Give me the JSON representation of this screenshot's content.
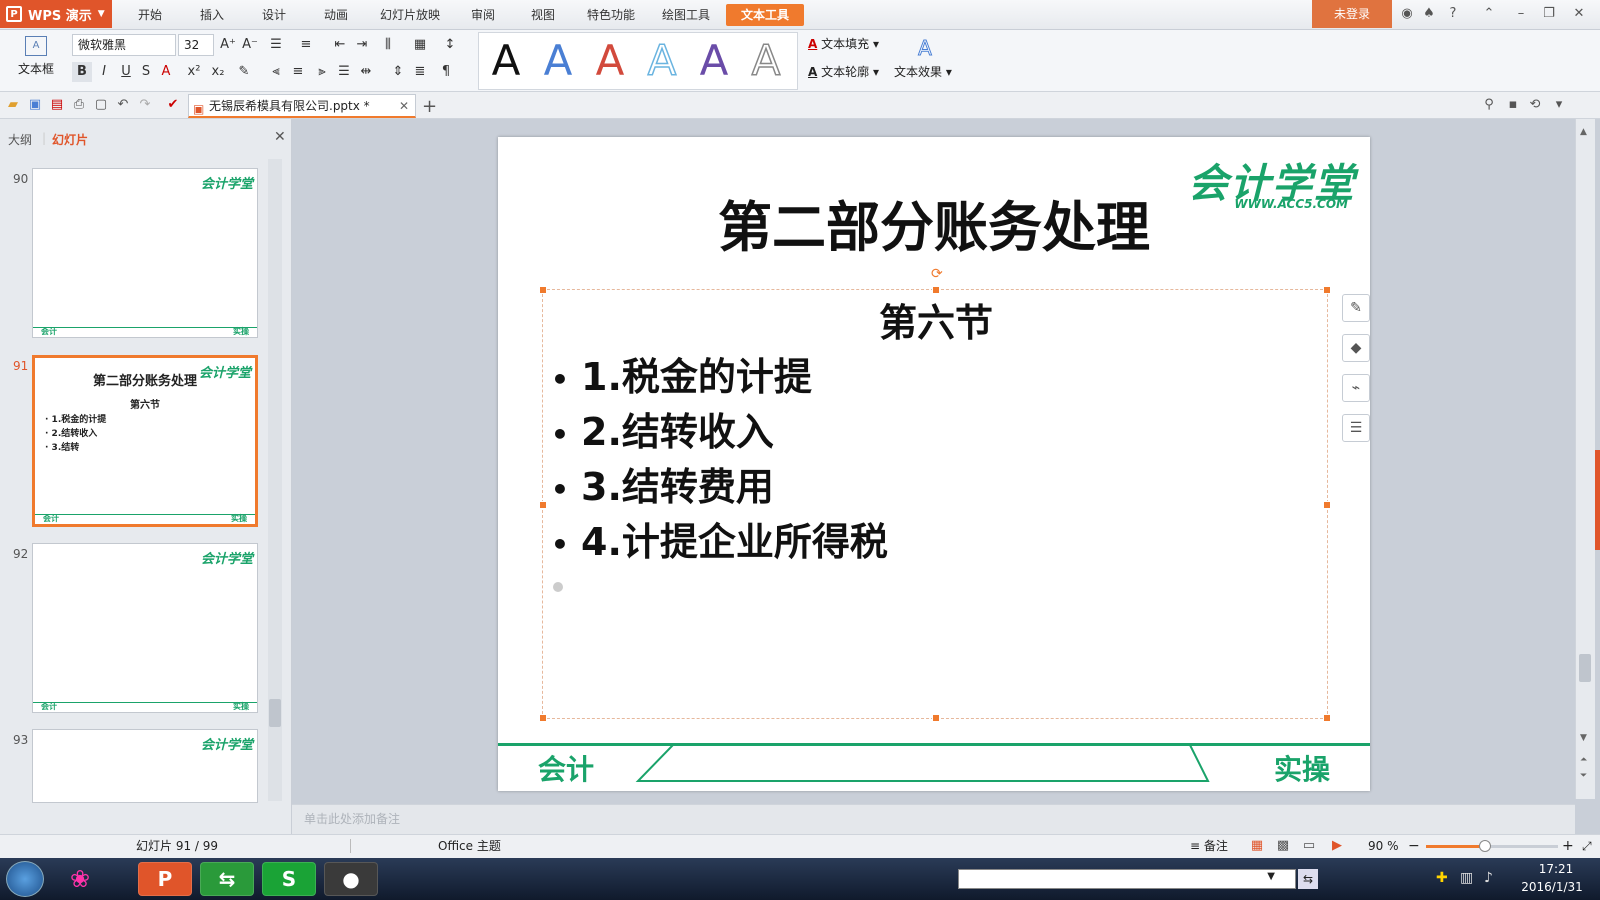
{
  "app": {
    "name": "WPS 演示",
    "login": "未登录"
  },
  "menu": [
    {
      "label": "开始"
    },
    {
      "label": "插入"
    },
    {
      "label": "设计"
    },
    {
      "label": "动画"
    },
    {
      "label": "幻灯片放映"
    },
    {
      "label": "审阅"
    },
    {
      "label": "视图"
    },
    {
      "label": "特色功能"
    },
    {
      "label": "绘图工具"
    },
    {
      "label": "文本工具"
    }
  ],
  "ribbon": {
    "textbox_label": "文本框",
    "font_name": "微软雅黑",
    "font_size": "32",
    "text_fill_label": "文本填充",
    "text_outline_label": "文本轮廓",
    "text_effect_label": "文本效果",
    "style_letter": "A"
  },
  "document": {
    "tab_title": "无锡辰希模具有限公司.pptx *"
  },
  "left_panel": {
    "tab_outline": "大纲",
    "tab_slides": "幻灯片",
    "thumbs": [
      {
        "num": "90"
      },
      {
        "num": "91",
        "title": "第二部分账务处理",
        "sub": "第六节",
        "items": [
          "· 1.税金的计提",
          "· 2.结转收入",
          "· 3.结转"
        ]
      },
      {
        "num": "92"
      },
      {
        "num": "93"
      }
    ],
    "thumb_logo": "会计学堂",
    "thumb_foot_left": "会计",
    "thumb_foot_right": "实操",
    "add_slide": "+"
  },
  "slide": {
    "logo": "会计学堂",
    "logo_sub": "WWW.ACC5.COM",
    "title": "第二部分账务处理",
    "subheading": "第六节",
    "bullets": [
      "1.税金的计提",
      "2.结转收入",
      "3.结转费用",
      "4.计提企业所得税"
    ],
    "footer_left": "会计",
    "footer_right": "实操"
  },
  "notes_placeholder": "单击此处添加备注",
  "status": {
    "slide_counter": "幻灯片 91 / 99",
    "theme": "Office 主题",
    "notes_label": "备注",
    "zoom": "90 %",
    "zoom_level": 0.45
  },
  "taskbar": {
    "time": "17:21",
    "date": "2016/1/31"
  },
  "colors": {
    "accent": "#f07a2d",
    "brand_green": "#1aa36a",
    "wps_red": "#e0552a"
  }
}
